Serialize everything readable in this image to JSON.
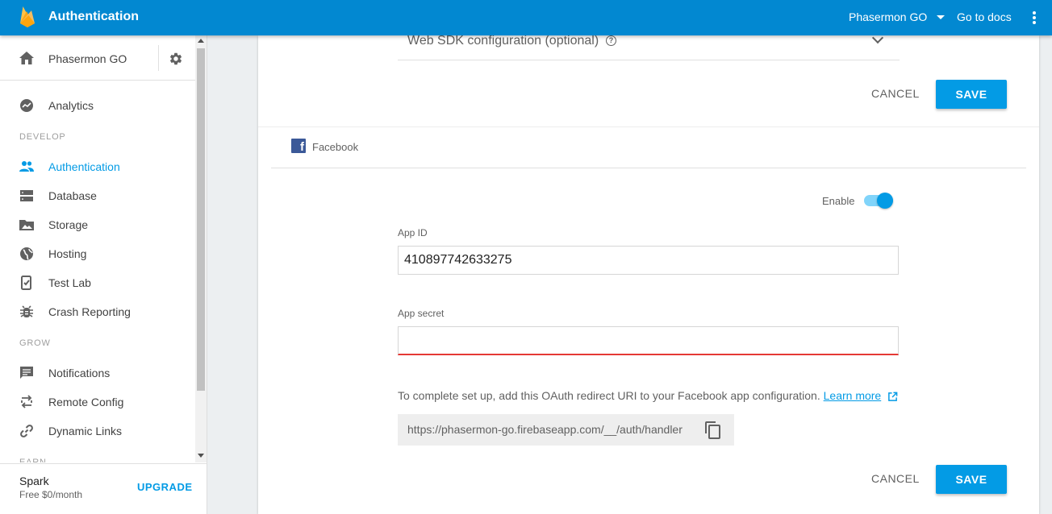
{
  "header": {
    "title": "Authentication",
    "project_name": "Phasermon GO",
    "docs_link": "Go to docs"
  },
  "sidebar": {
    "project_name": "Phasermon GO",
    "analytics": "Analytics",
    "sections": {
      "develop": "DEVELOP",
      "grow": "GROW",
      "earn": "EARN"
    },
    "develop_items": [
      {
        "label": "Authentication",
        "icon": "people-icon",
        "active": true
      },
      {
        "label": "Database",
        "icon": "database-icon"
      },
      {
        "label": "Storage",
        "icon": "image-folder-icon"
      },
      {
        "label": "Hosting",
        "icon": "globe-icon"
      },
      {
        "label": "Test Lab",
        "icon": "test-lab-icon"
      },
      {
        "label": "Crash Reporting",
        "icon": "bug-icon"
      }
    ],
    "grow_items": [
      {
        "label": "Notifications",
        "icon": "message-icon"
      },
      {
        "label": "Remote Config",
        "icon": "remote-config-icon"
      },
      {
        "label": "Dynamic Links",
        "icon": "link-icon"
      }
    ],
    "plan": {
      "name": "Spark",
      "price": "Free $0/month",
      "upgrade": "UPGRADE"
    }
  },
  "main": {
    "web_sdk_label": "Web SDK configuration (optional)",
    "cancel_label": "CANCEL",
    "save_label": "SAVE",
    "provider": {
      "name": "Facebook",
      "enable_label": "Enable",
      "enabled": true,
      "app_id_label": "App ID",
      "app_id_value": "410897742633275",
      "app_secret_label": "App secret",
      "app_secret_value": "",
      "info_text": "To complete set up, add this OAuth redirect URI to your Facebook app configuration.",
      "learn_more": "Learn more",
      "redirect_uri": "https://phasermon-go.firebaseapp.com/__/auth/handler"
    }
  },
  "colors": {
    "topbar": "#0288d1",
    "accent": "#039be5",
    "error": "#e53935",
    "facebook": "#3b5998"
  }
}
